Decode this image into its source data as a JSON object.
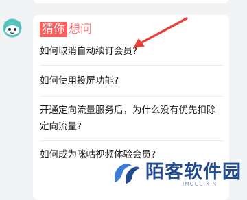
{
  "banner": {
    "highlight": "猜你",
    "rest": "想问"
  },
  "questions": [
    {
      "text": "如何取消自动续订会员?"
    },
    {
      "text": "如何使用投屏功能?"
    },
    {
      "text": "开通定向流量服务后，为什么没有优先扣除定向流量?"
    },
    {
      "text": "如何成为咪咕视频体验会员?"
    }
  ],
  "watermark": {
    "title": "陌客软件园",
    "subtitle": "IMOOC.XIN"
  },
  "colors": {
    "accent": "#ff5f5f",
    "arrow": "#e8413a",
    "watermark": "#214a8f"
  },
  "icons": {
    "avatar": "bot-avatar-icon",
    "logo": "watermark-logo-icon"
  }
}
